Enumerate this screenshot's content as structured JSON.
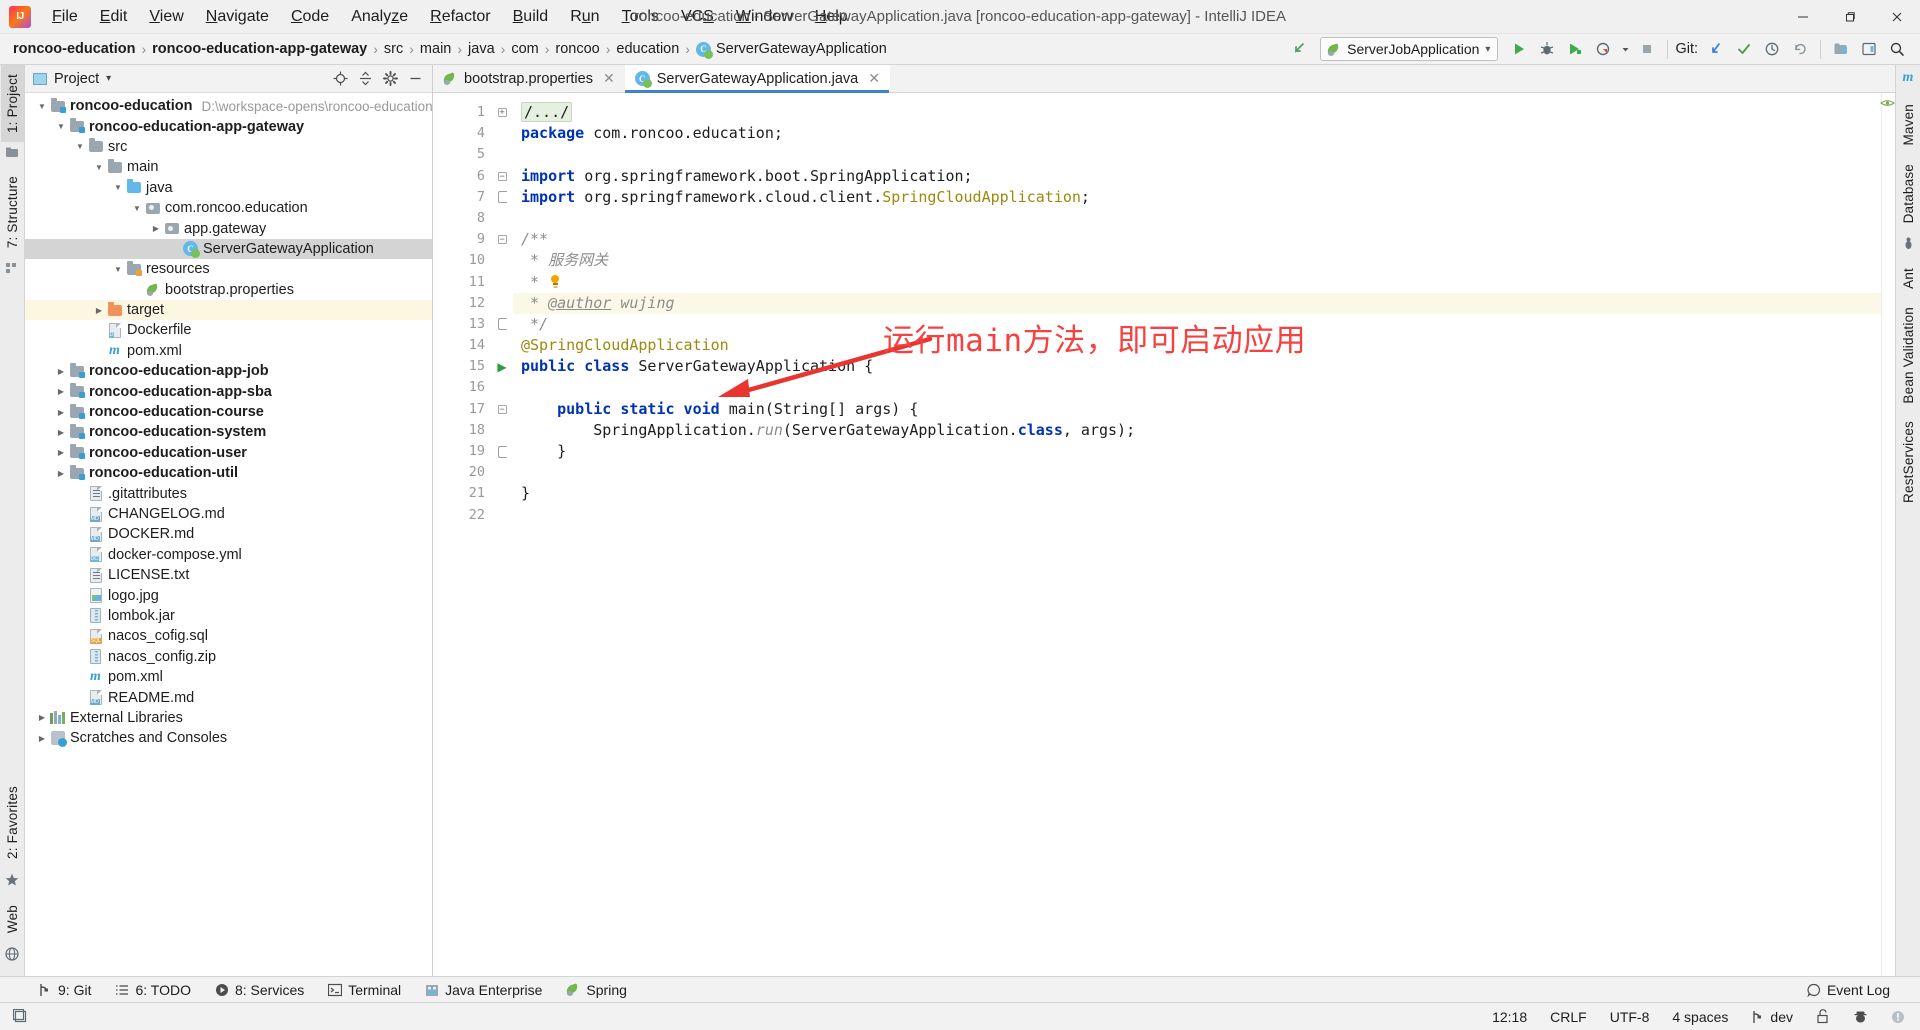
{
  "window": {
    "title": "roncoo-education - ServerGatewayApplication.java [roncoo-education-app-gateway] - IntelliJ IDEA",
    "minimize": "—",
    "maximize": "❐",
    "close": "✕",
    "logo_text": "IJ"
  },
  "menu": [
    {
      "label": "File"
    },
    {
      "label": "Edit"
    },
    {
      "label": "View"
    },
    {
      "label": "Navigate"
    },
    {
      "label": "Code"
    },
    {
      "label": "Analyze"
    },
    {
      "label": "Refactor"
    },
    {
      "label": "Build"
    },
    {
      "label": "Run"
    },
    {
      "label": "Tools"
    },
    {
      "label": "VCS"
    },
    {
      "label": "Window"
    },
    {
      "label": "Help"
    }
  ],
  "navbar": {
    "crumbs": [
      {
        "label": "roncoo-education",
        "bold": true,
        "icon": ""
      },
      {
        "label": "roncoo-education-app-gateway",
        "bold": true,
        "icon": ""
      },
      {
        "label": "src",
        "bold": false,
        "icon": ""
      },
      {
        "label": "main",
        "bold": false,
        "icon": ""
      },
      {
        "label": "java",
        "bold": false,
        "icon": ""
      },
      {
        "label": "com",
        "bold": false,
        "icon": ""
      },
      {
        "label": "roncoo",
        "bold": false,
        "icon": ""
      },
      {
        "label": "education",
        "bold": false,
        "icon": ""
      },
      {
        "label": "ServerGatewayApplication",
        "bold": false,
        "icon": "class-icon"
      }
    ],
    "separator": "›",
    "run_configuration": "ServerJobApplication",
    "run_config_caret": "▾",
    "git_label": "Git:"
  },
  "left_rail": {
    "top": [
      {
        "label": "1: Project",
        "active": true
      },
      {
        "label": "7: Structure",
        "active": false
      }
    ],
    "bottom": [
      {
        "label": "2: Favorites",
        "active": false
      },
      {
        "label": "Web",
        "active": false
      }
    ]
  },
  "right_rail": {
    "items": [
      {
        "label": "m"
      },
      {
        "label": "Maven"
      },
      {
        "label": "Database"
      },
      {
        "label": "Ant"
      },
      {
        "label": "Bean Validation"
      },
      {
        "label": "RestServices"
      }
    ]
  },
  "project_panel": {
    "title": "Project",
    "title_caret": "▾",
    "actions": [
      "locate-icon",
      "collapse-all-icon",
      "settings-icon",
      "hide-icon"
    ],
    "tree": [
      {
        "label": "roncoo-education",
        "sub": "D:\\workspace-opens\\roncoo-education",
        "depth": 0,
        "arrow": "open",
        "icon": "module-folder",
        "bold": true
      },
      {
        "label": "roncoo-education-app-gateway",
        "sub": "",
        "depth": 1,
        "arrow": "open",
        "icon": "module-folder",
        "bold": true
      },
      {
        "label": "src",
        "sub": "",
        "depth": 2,
        "arrow": "open",
        "icon": "folder",
        "bold": false
      },
      {
        "label": "main",
        "sub": "",
        "depth": 3,
        "arrow": "open",
        "icon": "folder",
        "bold": false
      },
      {
        "label": "java",
        "sub": "",
        "depth": 4,
        "arrow": "open",
        "icon": "source-folder",
        "bold": false
      },
      {
        "label": "com.roncoo.education",
        "sub": "",
        "depth": 5,
        "arrow": "open",
        "icon": "package",
        "bold": false
      },
      {
        "label": "app.gateway",
        "sub": "",
        "depth": 6,
        "arrow": "closed",
        "icon": "package",
        "bold": false
      },
      {
        "label": "ServerGatewayApplication",
        "sub": "",
        "depth": 7,
        "arrow": "none",
        "icon": "spring-class",
        "bold": false,
        "selected": true
      },
      {
        "label": "resources",
        "sub": "",
        "depth": 4,
        "arrow": "open",
        "icon": "resource-folder",
        "bold": false
      },
      {
        "label": "bootstrap.properties",
        "sub": "",
        "depth": 5,
        "arrow": "none",
        "icon": "spring-file",
        "bold": false
      },
      {
        "label": "target",
        "sub": "",
        "depth": 3,
        "arrow": "closed",
        "icon": "excluded-folder",
        "bold": false,
        "highlight": true
      },
      {
        "label": "Dockerfile",
        "sub": "",
        "depth": 3,
        "arrow": "none",
        "icon": "docker-file",
        "bold": false
      },
      {
        "label": "pom.xml",
        "sub": "",
        "depth": 3,
        "arrow": "none",
        "icon": "maven-file",
        "bold": false
      },
      {
        "label": "roncoo-education-app-job",
        "sub": "",
        "depth": 1,
        "arrow": "closed",
        "icon": "module-folder",
        "bold": true
      },
      {
        "label": "roncoo-education-app-sba",
        "sub": "",
        "depth": 1,
        "arrow": "closed",
        "icon": "module-folder",
        "bold": true
      },
      {
        "label": "roncoo-education-course",
        "sub": "",
        "depth": 1,
        "arrow": "closed",
        "icon": "module-folder",
        "bold": true
      },
      {
        "label": "roncoo-education-system",
        "sub": "",
        "depth": 1,
        "arrow": "closed",
        "icon": "module-folder",
        "bold": true
      },
      {
        "label": "roncoo-education-user",
        "sub": "",
        "depth": 1,
        "arrow": "closed",
        "icon": "module-folder",
        "bold": true
      },
      {
        "label": "roncoo-education-util",
        "sub": "",
        "depth": 1,
        "arrow": "closed",
        "icon": "module-folder",
        "bold": true
      },
      {
        "label": ".gitattributes",
        "sub": "",
        "depth": 2,
        "arrow": "none",
        "icon": "text-file",
        "bold": false
      },
      {
        "label": "CHANGELOG.md",
        "sub": "",
        "depth": 2,
        "arrow": "none",
        "icon": "md-file",
        "bold": false
      },
      {
        "label": "DOCKER.md",
        "sub": "",
        "depth": 2,
        "arrow": "none",
        "icon": "md-file",
        "bold": false
      },
      {
        "label": "docker-compose.yml",
        "sub": "",
        "depth": 2,
        "arrow": "none",
        "icon": "dc-file",
        "bold": false
      },
      {
        "label": "LICENSE.txt",
        "sub": "",
        "depth": 2,
        "arrow": "none",
        "icon": "text-file",
        "bold": false
      },
      {
        "label": "logo.jpg",
        "sub": "",
        "depth": 2,
        "arrow": "none",
        "icon": "image-file",
        "bold": false
      },
      {
        "label": "lombok.jar",
        "sub": "",
        "depth": 2,
        "arrow": "none",
        "icon": "jar-file",
        "bold": false
      },
      {
        "label": "nacos_cofig.sql",
        "sub": "",
        "depth": 2,
        "arrow": "none",
        "icon": "sql-file",
        "bold": false
      },
      {
        "label": "nacos_config.zip",
        "sub": "",
        "depth": 2,
        "arrow": "none",
        "icon": "zip-file",
        "bold": false
      },
      {
        "label": "pom.xml",
        "sub": "",
        "depth": 2,
        "arrow": "none",
        "icon": "maven-file",
        "bold": false
      },
      {
        "label": "README.md",
        "sub": "",
        "depth": 2,
        "arrow": "none",
        "icon": "md-file",
        "bold": false
      },
      {
        "label": "External Libraries",
        "sub": "",
        "depth": 0,
        "arrow": "closed",
        "icon": "libraries",
        "bold": false
      },
      {
        "label": "Scratches and Consoles",
        "sub": "",
        "depth": 0,
        "arrow": "closed",
        "icon": "scratches",
        "bold": false
      }
    ]
  },
  "editor": {
    "tabs": [
      {
        "label": "bootstrap.properties",
        "icon": "spring-file",
        "active": false,
        "close": "✕"
      },
      {
        "label": "ServerGatewayApplication.java",
        "icon": "spring-class",
        "active": true,
        "close": "✕"
      }
    ],
    "line_numbers": [
      "1",
      "4",
      "5",
      "6",
      "7",
      "8",
      "9",
      "10",
      "11",
      "12",
      "13",
      "14",
      "15",
      "16",
      "17",
      "18",
      "19",
      "20",
      "21",
      "22"
    ],
    "lines": [
      {
        "no": "1",
        "tokens": [
          {
            "t": "/.../",
            "c": "fold-text"
          }
        ],
        "fold": "plus"
      },
      {
        "no": "4",
        "tokens": [
          {
            "t": "package",
            "c": "k"
          },
          {
            "t": " com.roncoo.education;",
            "c": "mt"
          }
        ]
      },
      {
        "no": "5",
        "tokens": []
      },
      {
        "no": "6",
        "tokens": [
          {
            "t": "import",
            "c": "k"
          },
          {
            "t": " org.springframework.boot.SpringApplication;",
            "c": "mt"
          }
        ],
        "fold": "minus"
      },
      {
        "no": "7",
        "tokens": [
          {
            "t": "import",
            "c": "k"
          },
          {
            "t": " org.springframework.cloud.client.",
            "c": "mt"
          },
          {
            "t": "SpringCloudApplication",
            "c": "an"
          },
          {
            "t": ";",
            "c": "mt"
          }
        ],
        "fold": "brace"
      },
      {
        "no": "8",
        "tokens": []
      },
      {
        "no": "9",
        "tokens": [
          {
            "t": "/**",
            "c": "cm"
          }
        ],
        "fold": "minus",
        "mark": "doc"
      },
      {
        "no": "10",
        "tokens": [
          {
            "t": " * 服务网关",
            "c": "cm"
          }
        ]
      },
      {
        "no": "11",
        "tokens": [
          {
            "t": " *",
            "c": "cm"
          }
        ],
        "bulb": true
      },
      {
        "no": "12",
        "tokens": [
          {
            "t": " * ",
            "c": "cm"
          },
          {
            "t": "@author",
            "c": "cmu"
          },
          {
            "t": " wujing",
            "c": "cm"
          }
        ],
        "hl": true
      },
      {
        "no": "13",
        "tokens": [
          {
            "t": " */",
            "c": "cm"
          }
        ],
        "fold": "brace"
      },
      {
        "no": "14",
        "tokens": [
          {
            "t": "@SpringCloudApplication",
            "c": "an"
          }
        ]
      },
      {
        "no": "15",
        "tokens": [
          {
            "t": "public class",
            "c": "k"
          },
          {
            "t": " ServerGatewayApplication {",
            "c": "mt"
          }
        ],
        "run": true
      },
      {
        "no": "16",
        "tokens": []
      },
      {
        "no": "17",
        "tokens": [
          {
            "t": "    ",
            "c": "mt"
          },
          {
            "t": "public static void",
            "c": "k"
          },
          {
            "t": " ",
            "c": "mt"
          },
          {
            "t": "main",
            "c": "mt"
          },
          {
            "t": "(String[] args) {",
            "c": "mt"
          }
        ],
        "fold": "minus"
      },
      {
        "no": "18",
        "tokens": [
          {
            "t": "        SpringApplication.",
            "c": "mt"
          },
          {
            "t": "run",
            "c": "cm"
          },
          {
            "t": "(ServerGatewayApplication.",
            "c": "mt"
          },
          {
            "t": "class",
            "c": "k"
          },
          {
            "t": ", args);",
            "c": "mt"
          }
        ]
      },
      {
        "no": "19",
        "tokens": [
          {
            "t": "    }",
            "c": "mt"
          }
        ],
        "fold": "brace"
      },
      {
        "no": "20",
        "tokens": []
      },
      {
        "no": "21",
        "tokens": [
          {
            "t": "}",
            "c": "mt"
          }
        ]
      },
      {
        "no": "22",
        "tokens": []
      }
    ],
    "annotation": {
      "text": "运行main方法，即可启动应用",
      "color": "#f5413f"
    }
  },
  "toolstrip": {
    "items": [
      {
        "label": "9: Git",
        "icon": "git-icon",
        "mnemonic": "9"
      },
      {
        "label": "6: TODO",
        "icon": "todo-icon",
        "mnemonic": "6"
      },
      {
        "label": "8: Services",
        "icon": "services-icon",
        "mnemonic": "8"
      },
      {
        "label": "Terminal",
        "icon": "terminal-icon",
        "mnemonic": ""
      },
      {
        "label": "Java Enterprise",
        "icon": "java-enterprise-icon",
        "mnemonic": ""
      },
      {
        "label": "Spring",
        "icon": "spring-icon",
        "mnemonic": ""
      }
    ],
    "event_log": "Event Log"
  },
  "statusbar": {
    "caret_position": "12:18",
    "line_separator": "CRLF",
    "encoding": "UTF-8",
    "indent": "4 spaces",
    "branch": "dev",
    "icons": [
      "lock-icon",
      "inspector-icon",
      "notification-icon"
    ]
  },
  "colors": {
    "accent": "#4083c9",
    "annotation_red": "#f5413f",
    "keyword_blue": "#0033b3",
    "annotation_gold": "#9e880d",
    "comment_gray": "#8c8c8c",
    "selected_row": "#d4d4d4",
    "highlight_row": "#fdf7e2"
  }
}
